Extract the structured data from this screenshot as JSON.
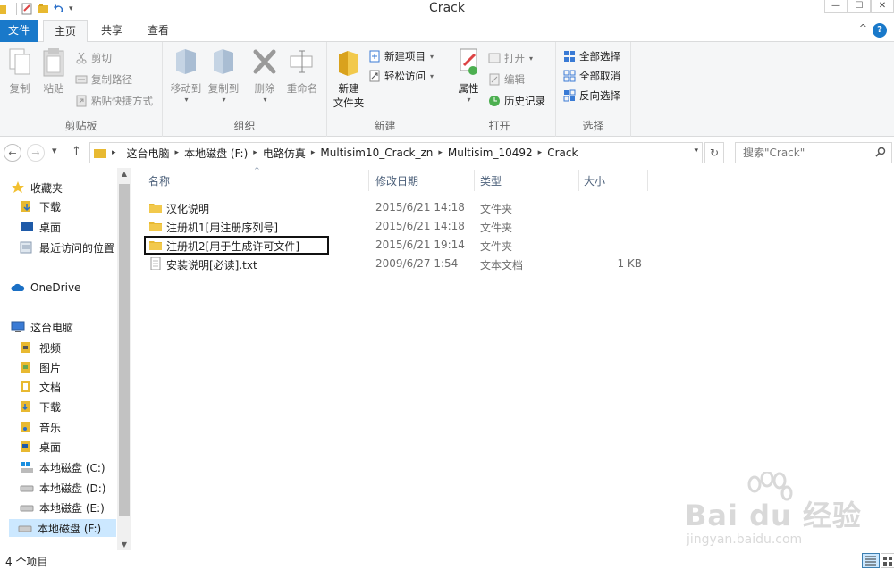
{
  "window": {
    "title": "Crack",
    "controls": {
      "minimize": "—",
      "maximize": "☐",
      "close": "✕"
    }
  },
  "tabs": {
    "file": "文件",
    "home": "主页",
    "share": "共享",
    "view": "查看"
  },
  "ribbon": {
    "clipboard": {
      "label": "剪贴板",
      "copy": "复制",
      "paste": "粘贴",
      "cut": "剪切",
      "copy_path": "复制路径",
      "paste_shortcut": "粘贴快捷方式"
    },
    "organize": {
      "label": "组织",
      "move_to": "移动到",
      "copy_to": "复制到",
      "delete": "删除",
      "rename": "重命名"
    },
    "new": {
      "label": "新建",
      "new_folder_line1": "新建",
      "new_folder_line2": "文件夹",
      "new_item": "新建项目",
      "easy_access": "轻松访问"
    },
    "open": {
      "label": "打开",
      "properties": "属性",
      "open": "打开",
      "edit": "编辑",
      "history": "历史记录"
    },
    "select": {
      "label": "选择",
      "select_all": "全部选择",
      "select_none": "全部取消",
      "invert": "反向选择"
    }
  },
  "address": {
    "crumbs": [
      "这台电脑",
      "本地磁盘 (F:)",
      "电路仿真",
      "Multisim10_Crack_zn",
      "Multisim_10492",
      "Crack"
    ],
    "search_placeholder": "搜索\"Crack\""
  },
  "sidebar": {
    "favorites": "收藏夹",
    "fav_items": [
      "下载",
      "桌面",
      "最近访问的位置"
    ],
    "onedrive": "OneDrive",
    "thispc": "这台电脑",
    "pc_items": [
      "视频",
      "图片",
      "文档",
      "下载",
      "音乐",
      "桌面",
      "本地磁盘 (C:)",
      "本地磁盘 (D:)",
      "本地磁盘 (E:)",
      "本地磁盘 (F:)"
    ]
  },
  "columns": {
    "name": "名称",
    "date": "修改日期",
    "type": "类型",
    "size": "大小"
  },
  "files": [
    {
      "name": "汉化说明",
      "date": "2015/6/21 14:18",
      "type": "文件夹",
      "size": ""
    },
    {
      "name": "注册机1[用注册序列号]",
      "date": "2015/6/21 14:18",
      "type": "文件夹",
      "size": ""
    },
    {
      "name": "注册机2[用于生成许可文件]",
      "date": "2015/6/21 19:14",
      "type": "文件夹",
      "size": ""
    },
    {
      "name": "安装说明[必读].txt",
      "date": "2009/6/27 1:54",
      "type": "文本文档",
      "size": "1 KB"
    }
  ],
  "status": {
    "count": "4 个项目"
  },
  "watermark": {
    "brand": "Bai du 经验",
    "url": "jingyan.baidu.com"
  },
  "colors": {
    "accent": "#1979ca",
    "selection": "#cce8ff",
    "folder": "#e8b931"
  }
}
